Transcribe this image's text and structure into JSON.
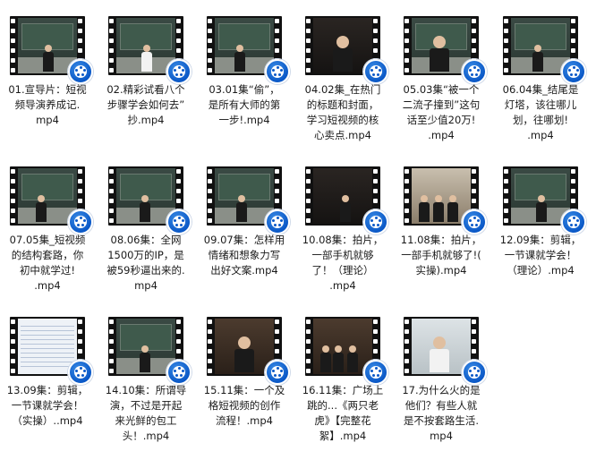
{
  "files": [
    {
      "name": "01.宣导片：短视频导演养成记.mp4",
      "lines": [
        "01.宣导片：短视",
        "频导演养成记.",
        "mp4"
      ]
    },
    {
      "name": "02.精彩试看八个步骤学会如何去”抄.mp4",
      "lines": [
        "02.精彩试看八个",
        "步骤学会如何去”",
        "抄.mp4"
      ]
    },
    {
      "name": "03.01集“偷”，是所有大师的第一步!.mp4",
      "lines": [
        "03.01集“偷”，",
        "是所有大师的第",
        "一步!.mp4"
      ]
    },
    {
      "name": "04.02集_在热门的标题和封面，学习短视频的核心卖点.mp4",
      "lines": [
        "04.02集_在热门",
        "的标题和封面，",
        "学习短视频的核",
        "心卖点.mp4"
      ]
    },
    {
      "name": "05.03集“被一个二流子撞到”这句话至少值20万!.mp4",
      "lines": [
        "05.03集“被一个",
        "二流子撞到”这句",
        "话至少值20万!",
        ".mp4"
      ]
    },
    {
      "name": "06.04集_结尾是灯塔，该往哪儿划，往哪划!.mp4",
      "lines": [
        "06.04集_结尾是",
        "灯塔，该往哪儿",
        "划，往哪划!",
        ".mp4"
      ]
    },
    {
      "name": "07.05集_短视频的结构套路，你初中就学过!.mp4",
      "lines": [
        "07.05集_短视频",
        "的结构套路，你",
        "初中就学过!",
        ".mp4"
      ]
    },
    {
      "name": "08.06集：全网1500万的IP，是被59秒逼出来的.mp4",
      "lines": [
        "08.06集：全网",
        "1500万的IP，是",
        "被59秒逼出来的.",
        "mp4"
      ]
    },
    {
      "name": "09.07集：怎样用情绪和想象力写出好文案.mp4",
      "lines": [
        "09.07集：怎样用",
        "情绪和想象力写",
        "出好文案.mp4"
      ]
    },
    {
      "name": "10.08集：拍片，一部手机就够了！（理论）.mp4",
      "lines": [
        "10.08集：拍片，",
        "一部手机就够",
        "了！（理论）",
        ".mp4"
      ]
    },
    {
      "name": "11.08集：拍片，一部手机就够了!(实操).mp4",
      "lines": [
        "11.08集：拍片，",
        "一部手机就够了!(",
        "实操).mp4"
      ]
    },
    {
      "name": "12.09集：剪辑，一节课就学会！（理论）.mp4",
      "lines": [
        "12.09集：剪辑，",
        "一节课就学会！",
        "（理论）.mp4"
      ]
    },
    {
      "name": "13.09集：剪辑，一节课就学会！（实操）.mp4",
      "lines": [
        "13.09集：剪辑，",
        "一节课就学会！",
        "（实操）..mp4"
      ]
    },
    {
      "name": "14.10集：所谓导演，不过是开起来光鲜的包工头！.mp4",
      "lines": [
        "14.10集：所谓导",
        "演，不过是开起",
        "来光鲜的包工",
        "头！.mp4"
      ]
    },
    {
      "name": "15.11集：一个及格短视频的创作流程！.mp4",
      "lines": [
        "15.11集：一个及",
        "格短视频的创作",
        "流程！.mp4"
      ]
    },
    {
      "name": "16.11集：广场上跳的...《两只老虎》【完整花絮】.mp4",
      "lines": [
        "16.11集：广场上",
        "跳的...《两只老",
        "虎》【完整花",
        "絮】.mp4"
      ]
    },
    {
      "name": "17.为什么火的是他们？有些人就是不按套路生活.mp4",
      "lines": [
        "17.为什么火的是",
        "他们？有些人就",
        "是不按套路生活.",
        "mp4"
      ]
    }
  ],
  "colors": {
    "badge": "#0a58c7",
    "film": "#111111"
  }
}
